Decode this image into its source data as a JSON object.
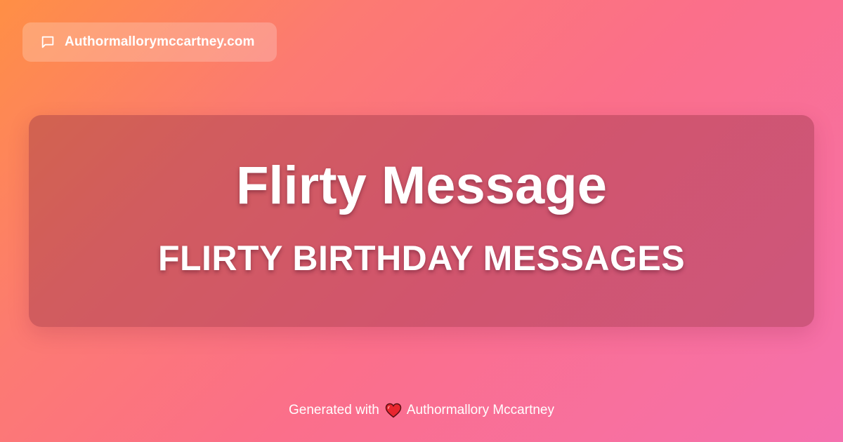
{
  "badge": {
    "icon": "chat-bubble-icon",
    "domain": "Authormallorymccartney.com"
  },
  "hero": {
    "title": "Flirty Message",
    "subtitle": "FLIRTY BIRTHDAY MESSAGES"
  },
  "footer": {
    "prefix": "Generated with",
    "icon": "heart-icon",
    "author": "Authormallory Mccartney"
  },
  "colors": {
    "gradient_start": "#ff8f45",
    "gradient_mid": "#fb6f8a",
    "gradient_end": "#f570ae",
    "heart": "#e8262f",
    "text": "#ffffff"
  }
}
